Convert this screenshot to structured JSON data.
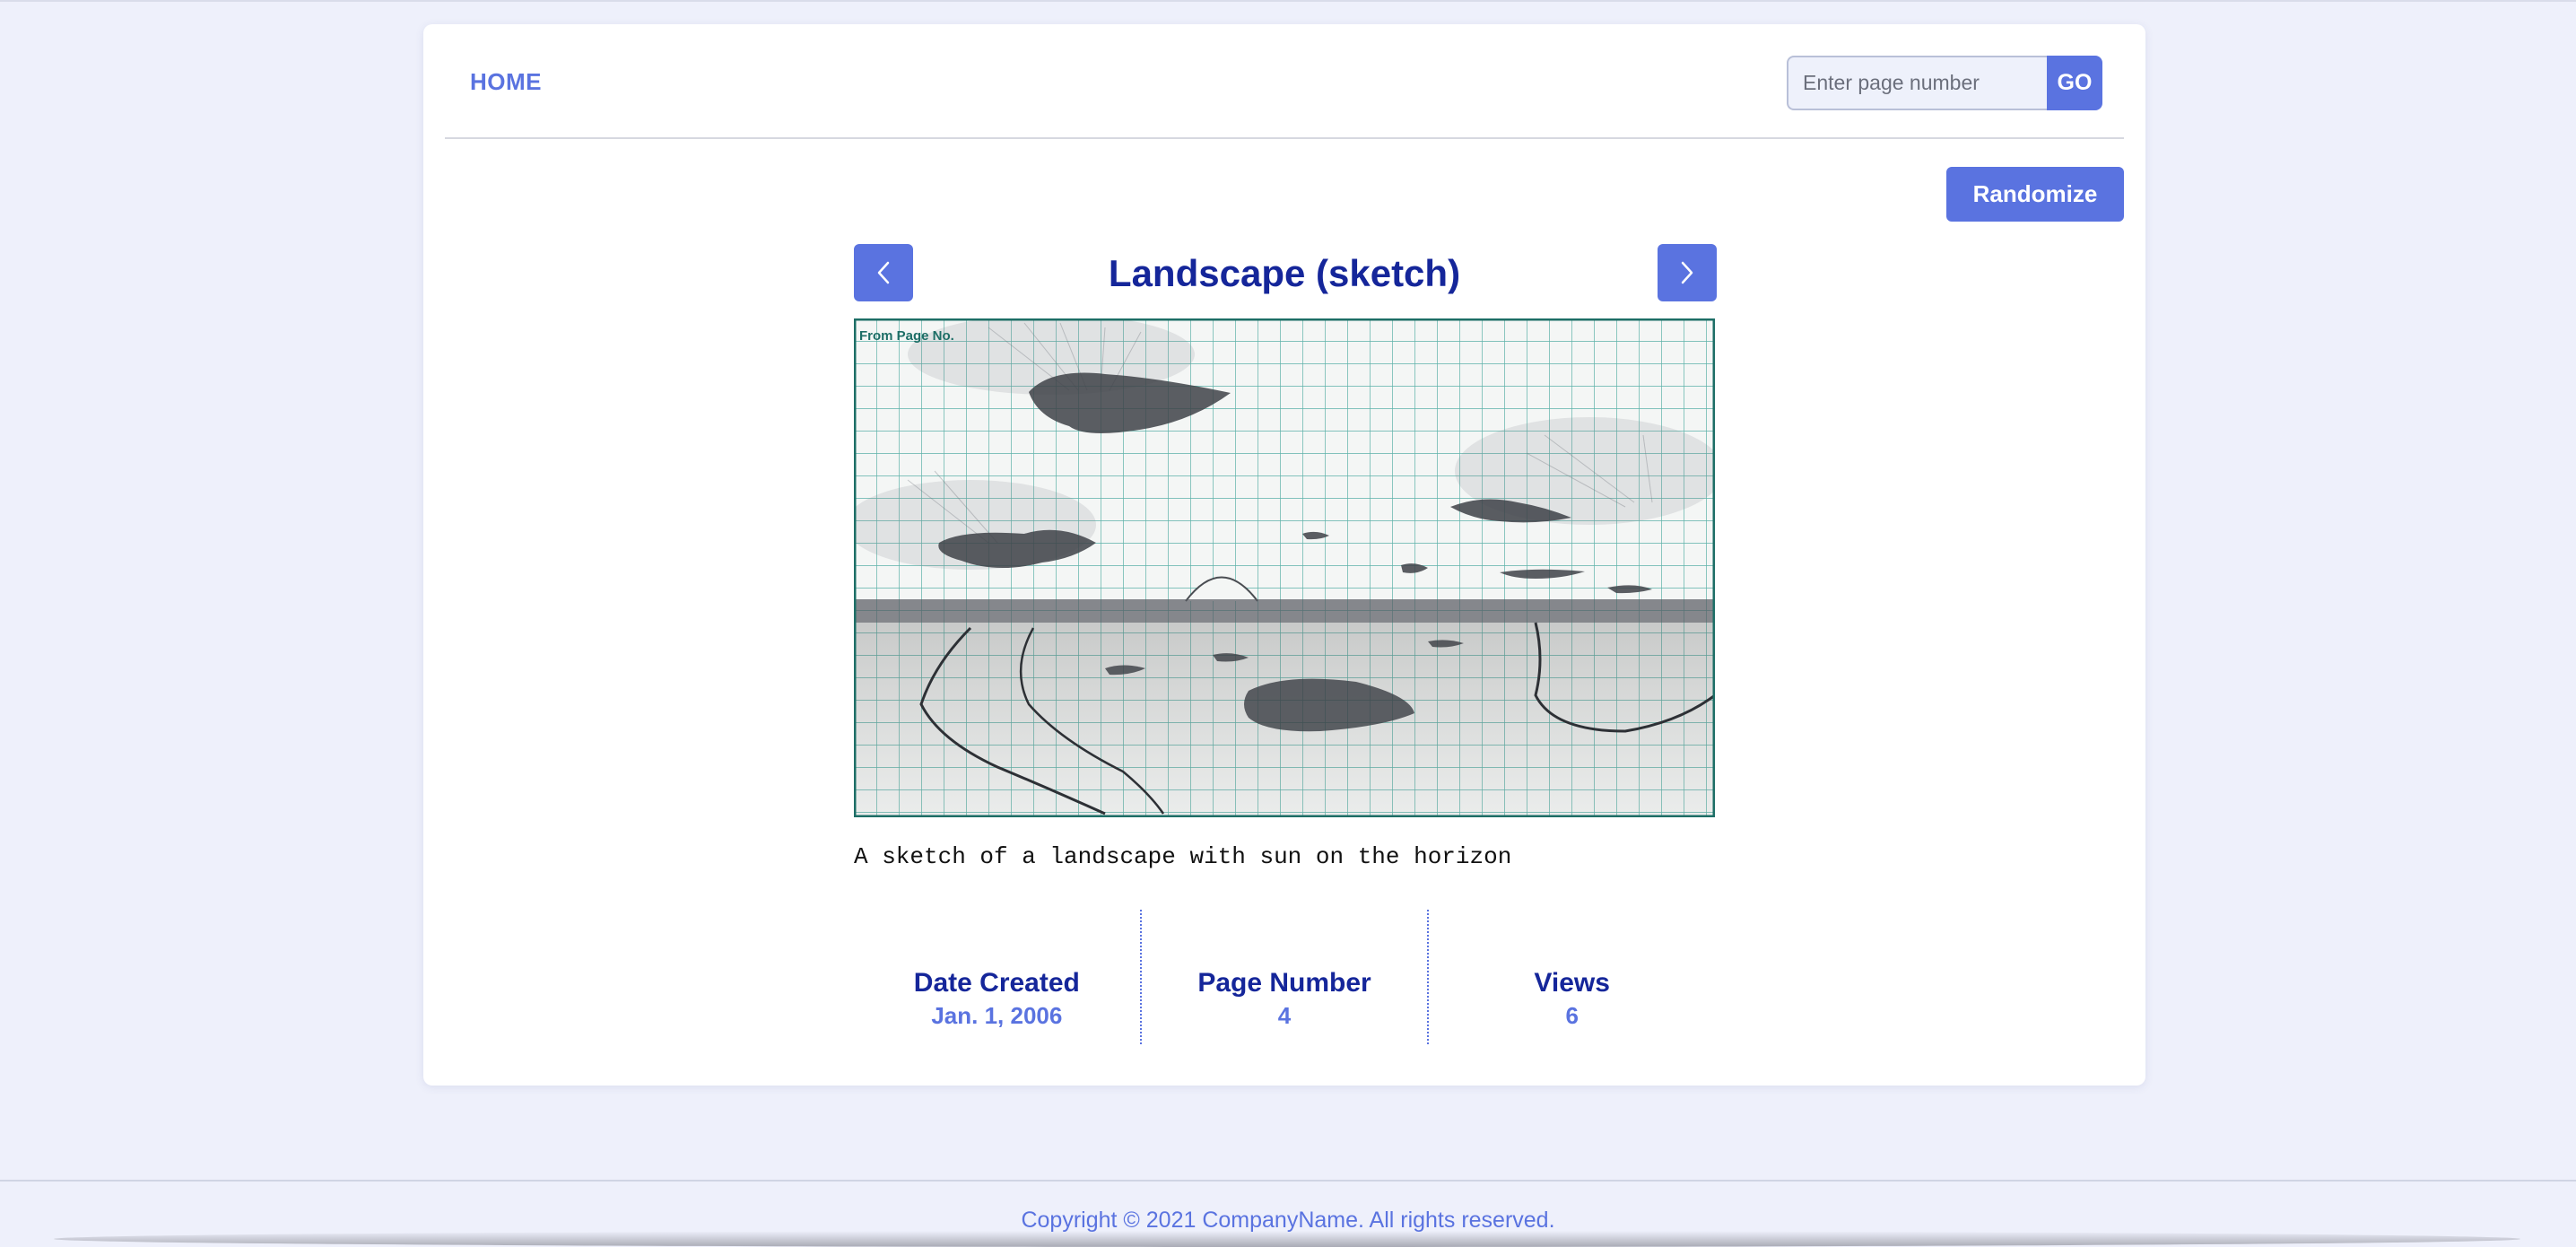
{
  "nav": {
    "home_label": "HOME",
    "page_input_placeholder": "Enter page number",
    "go_label": "GO"
  },
  "randomize_label": "Randomize",
  "entry": {
    "title": "Landscape (sketch)",
    "image_label": "From Page No.",
    "caption": "A sketch of a landscape with sun on the horizon",
    "stats": [
      {
        "label": "Date Created",
        "value": "Jan. 1, 2006"
      },
      {
        "label": "Page Number",
        "value": "4"
      },
      {
        "label": "Views",
        "value": "6"
      }
    ]
  },
  "footer": {
    "copyright": "Copyright © 2021 CompanyName. All rights reserved."
  },
  "colors": {
    "accent": "#5a73e0",
    "heading": "#15269a",
    "page_bg": "#eef0fb",
    "grid": "#2a9a8e"
  },
  "icons": {
    "prev": "chevron-left-icon",
    "next": "chevron-right-icon"
  }
}
